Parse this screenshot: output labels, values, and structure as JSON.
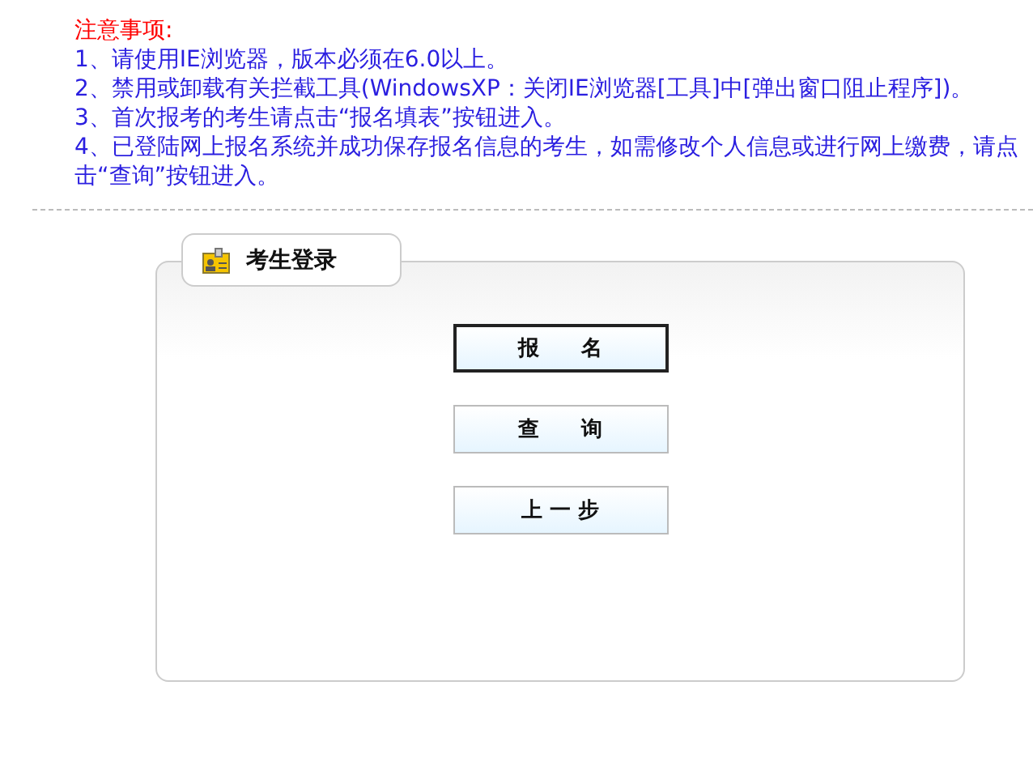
{
  "notice": {
    "title": "注意事项:",
    "items": [
      "1、请使用IE浏览器，版本必须在6.0以上。",
      "2、禁用或卸载有关拦截工具(WindowsXP：关闭IE浏览器[工具]中[弹出窗口阻止程序])。",
      "3、首次报考的考生请点击“报名填表”按钮进入。",
      "4、已登陆网上报名系统并成功保存报名信息的考生，如需修改个人信息或进行网上缴费，请点击“查询”按钮进入。"
    ]
  },
  "panel": {
    "title": "考生登录",
    "buttons": [
      {
        "label": "报　　名",
        "focused": true
      },
      {
        "label": "查　　询",
        "focused": false
      },
      {
        "label": "上 一 步",
        "focused": false
      }
    ]
  }
}
